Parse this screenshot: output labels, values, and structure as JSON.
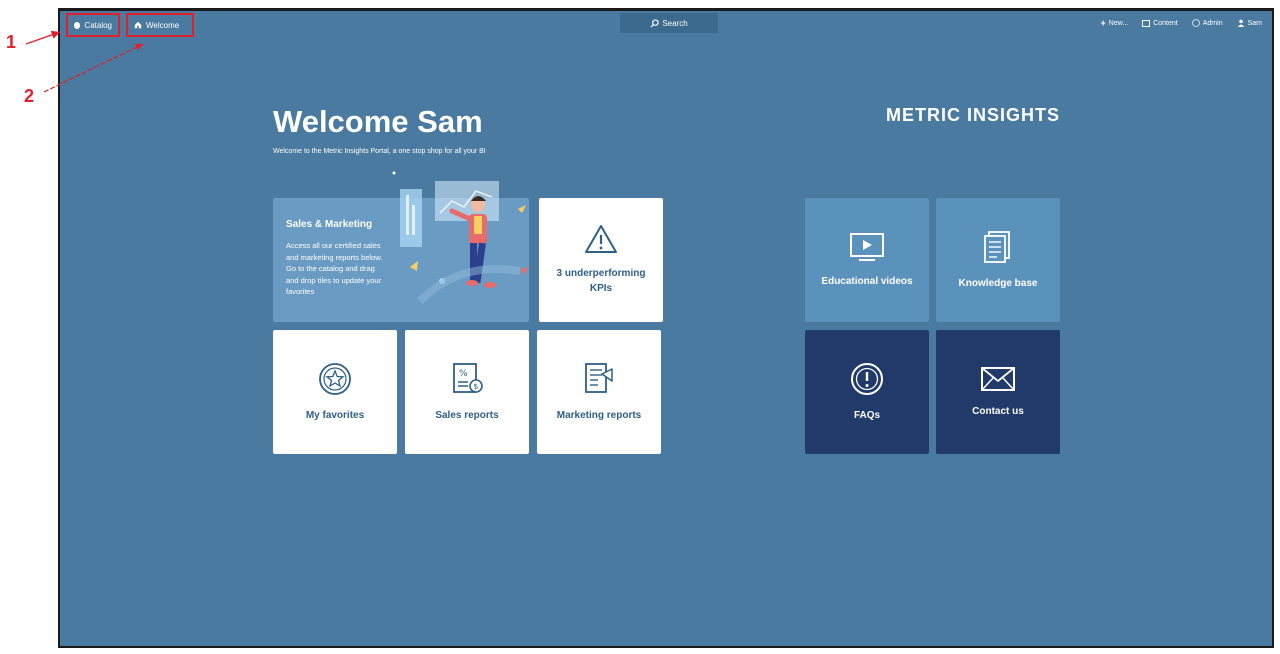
{
  "annotations": {
    "one": "1",
    "two": "2"
  },
  "nav": {
    "catalog": "Catalog",
    "welcome": "Welcome",
    "search": "Search",
    "new": "New...",
    "content": "Content",
    "admin": "Admin",
    "user": "Sam"
  },
  "hero": {
    "title": "Welcome Sam",
    "subtitle": "Welcome to the Metric Insights Portal, a one stop shop for all your BI",
    "brand": "METRIC INSIGHTS"
  },
  "tiles": {
    "sales_marketing": {
      "title": "Sales & Marketing",
      "desc": "Access all our certified sales and marketing reports below. Go to the catalog and drag and drop tiles to update your favorites"
    },
    "kpis": "3 underperforming KPIs",
    "favorites": "My favorites",
    "sales_reports": "Sales reports",
    "marketing_reports": "Marketing reports",
    "educational_videos": "Educational videos",
    "knowledge_base": "Knowledge base",
    "faqs": "FAQs",
    "contact": "Contact us"
  },
  "colors": {
    "background": "#4a7a9f",
    "tile_light": "#5b92bb",
    "tile_dark": "#213a6a",
    "annotation": "#e0202a"
  }
}
